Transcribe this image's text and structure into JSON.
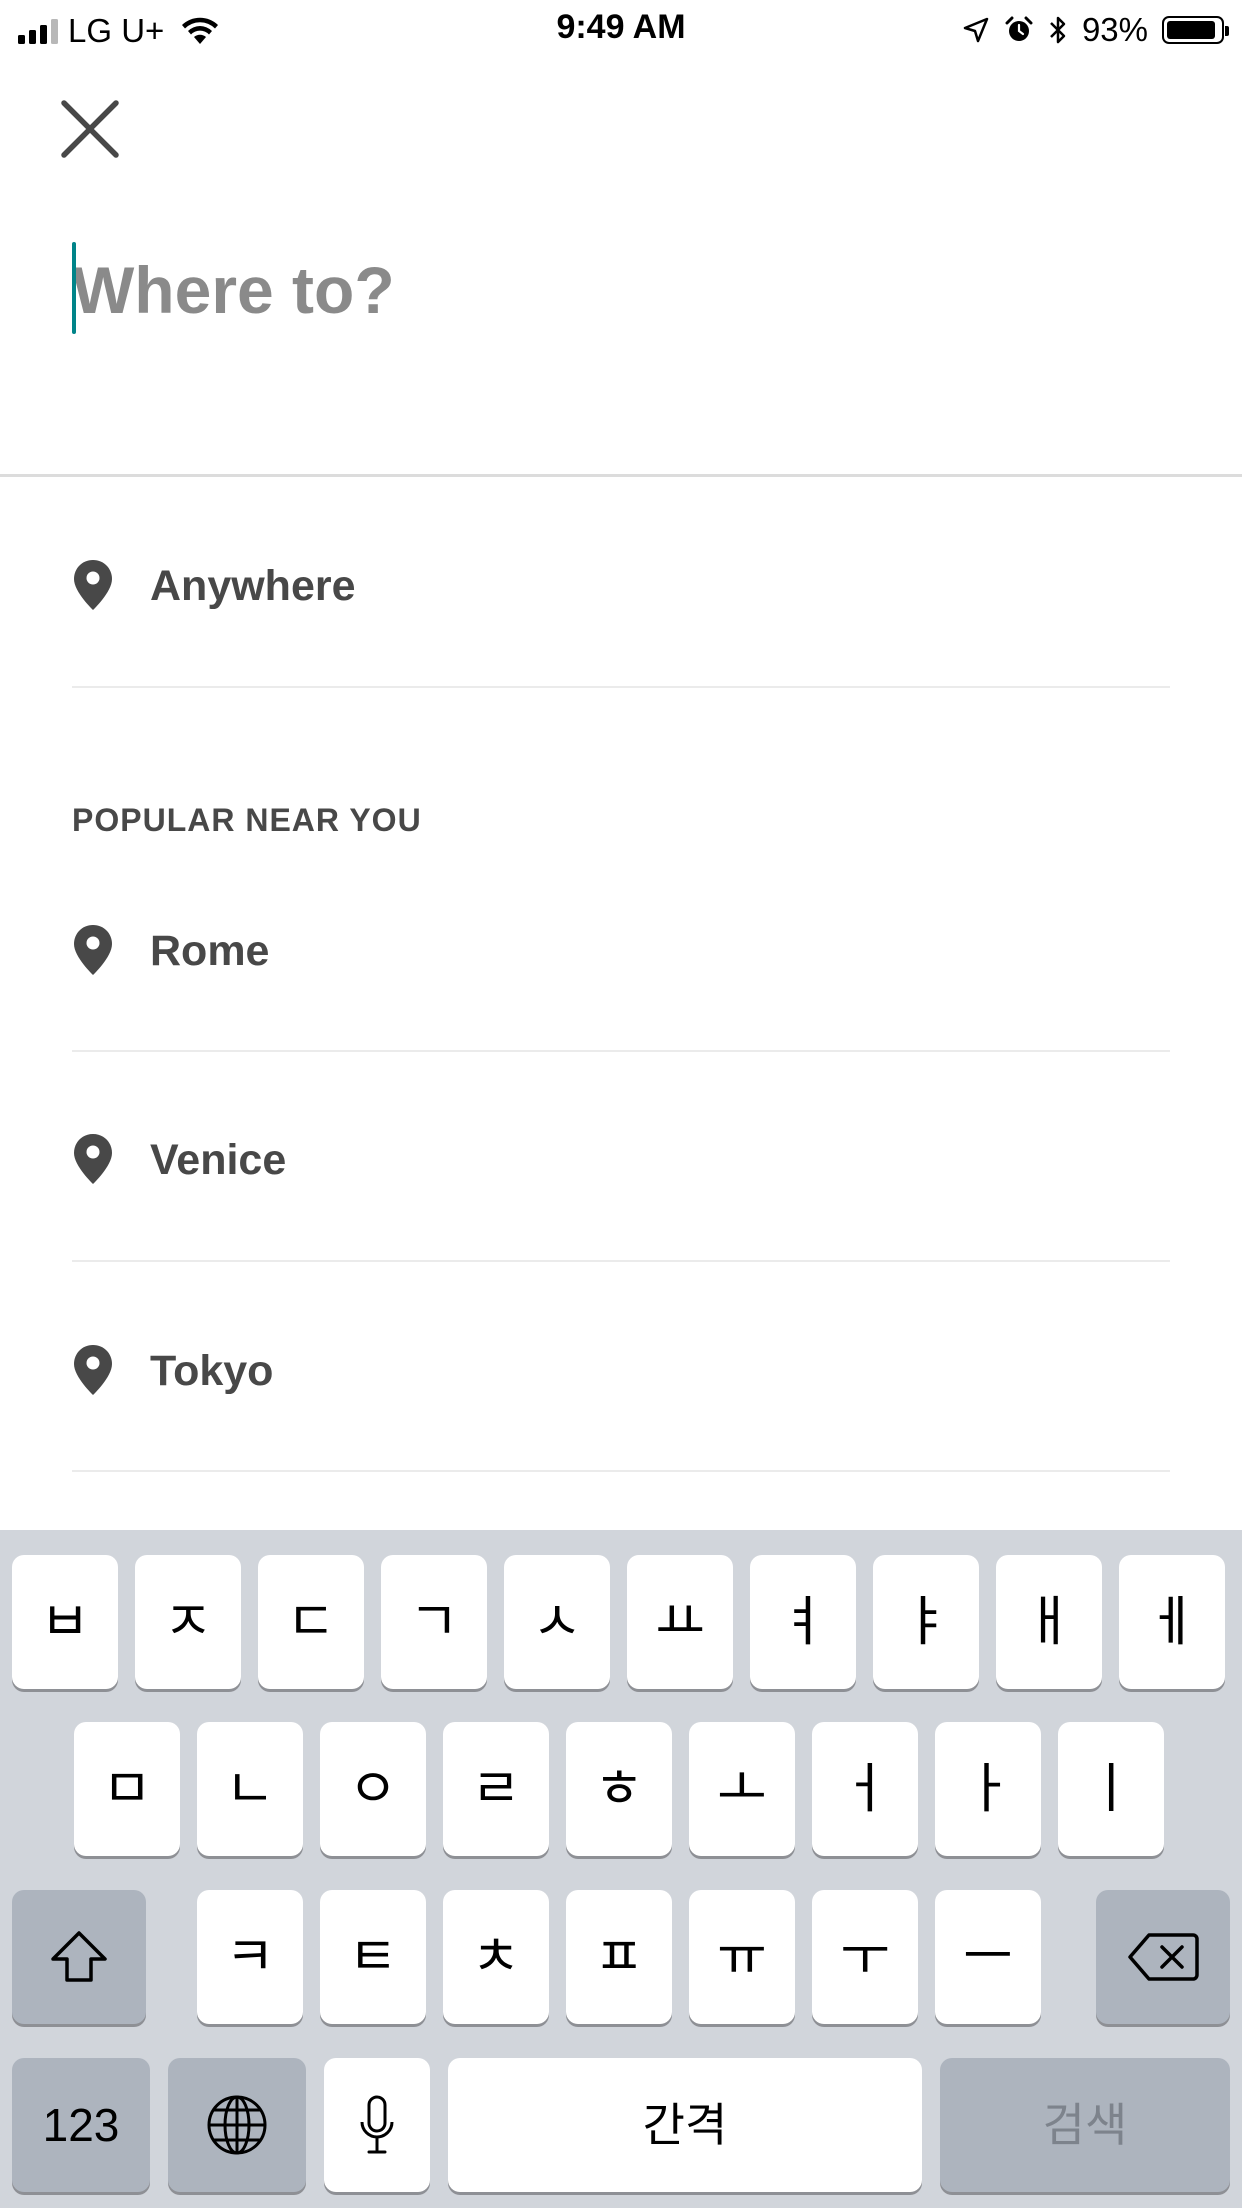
{
  "status_bar": {
    "carrier": "LG U+",
    "time": "9:49 AM",
    "battery_percent": "93%",
    "battery_level": 0.93,
    "signal_bars": 3,
    "icons": [
      "signal-icon",
      "wifi-icon",
      "location-arrow-icon",
      "alarm-icon",
      "bluetooth-icon",
      "battery-icon"
    ]
  },
  "header": {
    "close_icon": "close-icon"
  },
  "search": {
    "placeholder": "Where to?",
    "value": ""
  },
  "anywhere": {
    "label": "Anywhere",
    "icon": "map-pin-icon"
  },
  "popular": {
    "title": "POPULAR NEAR YOU",
    "items": [
      {
        "label": "Rome",
        "icon": "map-pin-icon"
      },
      {
        "label": "Venice",
        "icon": "map-pin-icon"
      },
      {
        "label": "Tokyo",
        "icon": "map-pin-icon"
      }
    ]
  },
  "keyboard": {
    "row1": [
      "ㅂ",
      "ㅈ",
      "ㄷ",
      "ㄱ",
      "ㅅ",
      "ㅛ",
      "ㅕ",
      "ㅑ",
      "ㅐ",
      "ㅔ"
    ],
    "row2": [
      "ㅁ",
      "ㄴ",
      "ㅇ",
      "ㄹ",
      "ㅎ",
      "ㅗ",
      "ㅓ",
      "ㅏ",
      "ㅣ"
    ],
    "row3": [
      "ㅋ",
      "ㅌ",
      "ㅊ",
      "ㅍ",
      "ㅠ",
      "ㅜ",
      "ㅡ"
    ],
    "numbers_label": "123",
    "space_label": "간격",
    "search_label": "검색",
    "shift_icon": "shift-icon",
    "backspace_icon": "backspace-icon",
    "globe_icon": "globe-icon",
    "mic_icon": "microphone-icon"
  },
  "colors": {
    "text": "#484848",
    "placeholder": "#8a8a8a",
    "cursor": "#008489",
    "keyboard_bg": "#d1d5db",
    "key_dark": "#adb4be"
  }
}
